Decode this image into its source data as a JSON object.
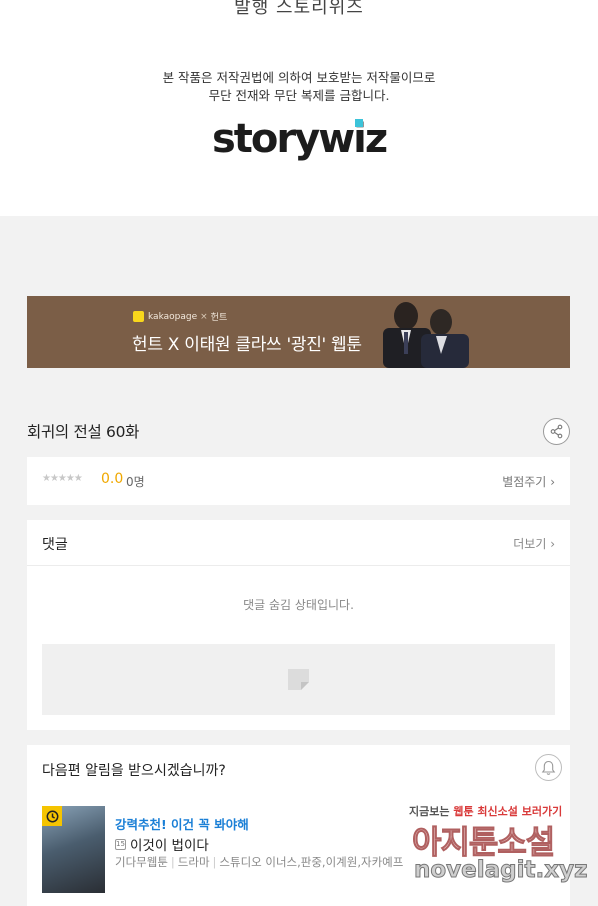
{
  "header": {
    "publisher_line": "발행 스토리위즈",
    "copyright_line1": "본 작품은 저작권법에 의하여 보호받는 저작물이므로",
    "copyright_line2": "무단 전재와 무단 복제를 금합니다.",
    "logo_text": "storywiz"
  },
  "banner": {
    "brand": "kakaopage",
    "cross": "×",
    "partner": "헌트",
    "title": "헌트 X 이태원 클라쓰 '광진' 웹툰"
  },
  "episode": {
    "title": "회귀의 전설 60화"
  },
  "rating": {
    "stars": "★★★★★",
    "score": "0.0",
    "count": "0명",
    "rate_link": "별점주기",
    "rating_fraction": 0
  },
  "comments": {
    "title": "댓글",
    "more_link": "더보기",
    "hidden_message": "댓글 숨김 상태입니다."
  },
  "notify": {
    "question": "다음편 알림을 받으시겠습니까?"
  },
  "recommendation": {
    "label": "강력추천! 이건 꼭 봐야해",
    "age_badge": "15",
    "title": "이것이 법이다",
    "meta": [
      "기다무웹툰",
      "드라마",
      "스튜디오 이너스,판중,이계원,자카예프"
    ]
  },
  "watermark": {
    "top_dark1": "지금보는",
    "top_red1": "웹툰",
    "top_dark2": "최신소설",
    "top_red2": "보러가기",
    "main": "아지툰소설",
    "url": "novelagit.xyz"
  },
  "colors": {
    "banner_bg": "#7b5e47",
    "score": "#f0a800",
    "rec_label": "#1a7fd6"
  }
}
